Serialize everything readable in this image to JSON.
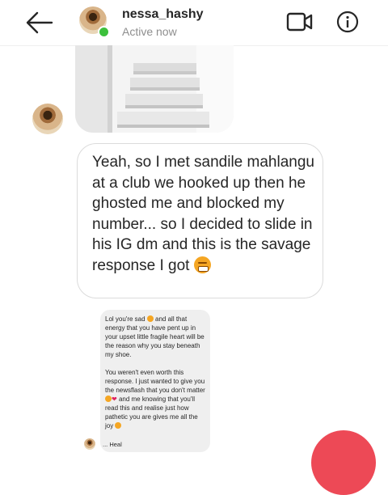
{
  "header": {
    "username": "nessa_hashy",
    "status": "Active now",
    "icons": {
      "back": "arrow-left-icon",
      "video": "video-camera-icon",
      "info": "info-icon"
    },
    "online_color": "#3cc03c"
  },
  "thread": {
    "image_message": {
      "description_icon": "staircase-photo"
    },
    "message": {
      "text": "Yeah, so I met sandile mahlangu at a club we hooked up then he ghosted me and blocked my number... so I decided to slide in his IG dm and this is the savage response I got",
      "emoji": "grimacing-face-emoji"
    },
    "screenshot": {
      "paragraph_1": "Lol you're sad",
      "paragraph_1_rest": "and all that energy that you have pent up in your upset little fragile heart will be the reason why you stay beneath my shoe.",
      "paragraph_2": "You weren't even worth this response. I just wanted to give you the newsflash that you don't matter",
      "paragraph_2_mid": "and me knowing that you'll read this and realise just how pathetic you are gives me all the joy",
      "reply": "... Heal"
    }
  },
  "colors": {
    "accent_fab": "#ed4956",
    "bubble_border": "#dbdbdb",
    "secondary_text": "#8e8e8e"
  }
}
